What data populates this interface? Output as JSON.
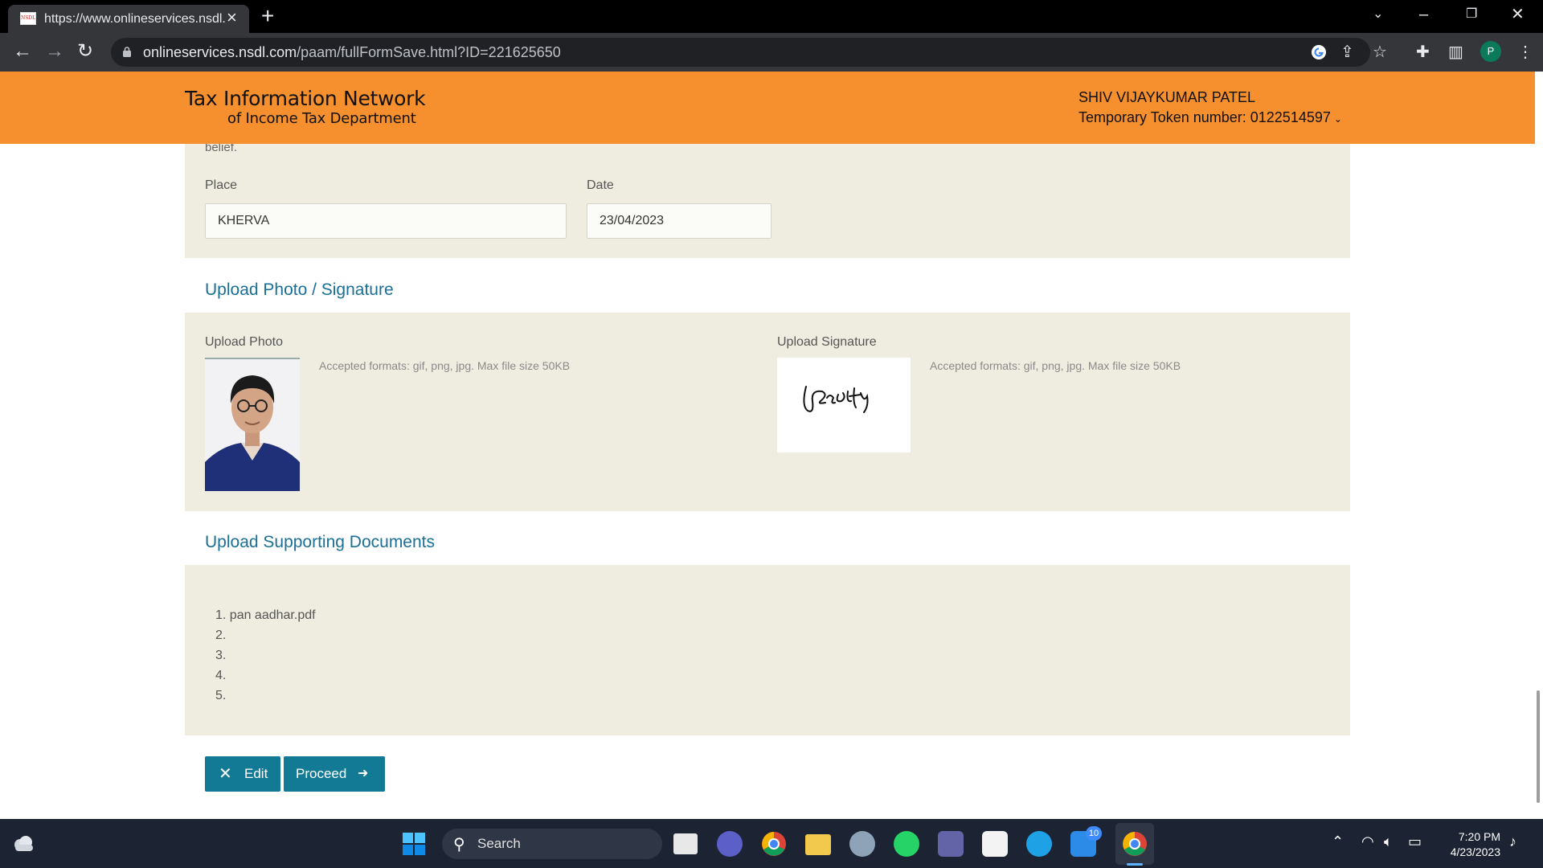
{
  "browser": {
    "tab_title": "https://www.onlineservices.nsdl.c",
    "tab_favicon_text": "NSDL",
    "url_host": "onlineservices.nsdl.com",
    "url_path": "/paam/fullFormSave.html?ID=221625650"
  },
  "header": {
    "logo_line1": "Tax Information Network",
    "logo_line2": "of Income Tax Department",
    "user_name": "SHIV VIJAYKUMAR PATEL",
    "token_label": "Temporary Token number: 0122514597"
  },
  "declaration": {
    "partial_text": "belief.",
    "place_label": "Place",
    "place_value": "KHERVA",
    "date_label": "Date",
    "date_value": "23/04/2023"
  },
  "upload": {
    "section_title": "Upload Photo / Signature",
    "photo_label": "Upload Photo",
    "photo_hint": "Accepted formats: gif, png, jpg. Max file size 50KB",
    "signature_label": "Upload Signature",
    "signature_hint": "Accepted formats: gif, png, jpg. Max file size 50KB"
  },
  "documents": {
    "section_title": "Upload Supporting Documents",
    "items": [
      "1. pan aadhar.pdf",
      "2.",
      "3.",
      "4.",
      "5."
    ]
  },
  "actions": {
    "edit_label": "Edit",
    "proceed_label": "Proceed"
  },
  "taskbar": {
    "search_label": "Search",
    "mail_badge": "10",
    "time": "7:20 PM",
    "date": "4/23/2023"
  },
  "colors": {
    "header_bg": "#f68f2d",
    "panel_bg": "#efeddf",
    "accent": "#137a96",
    "section_title": "#1a6f97"
  }
}
